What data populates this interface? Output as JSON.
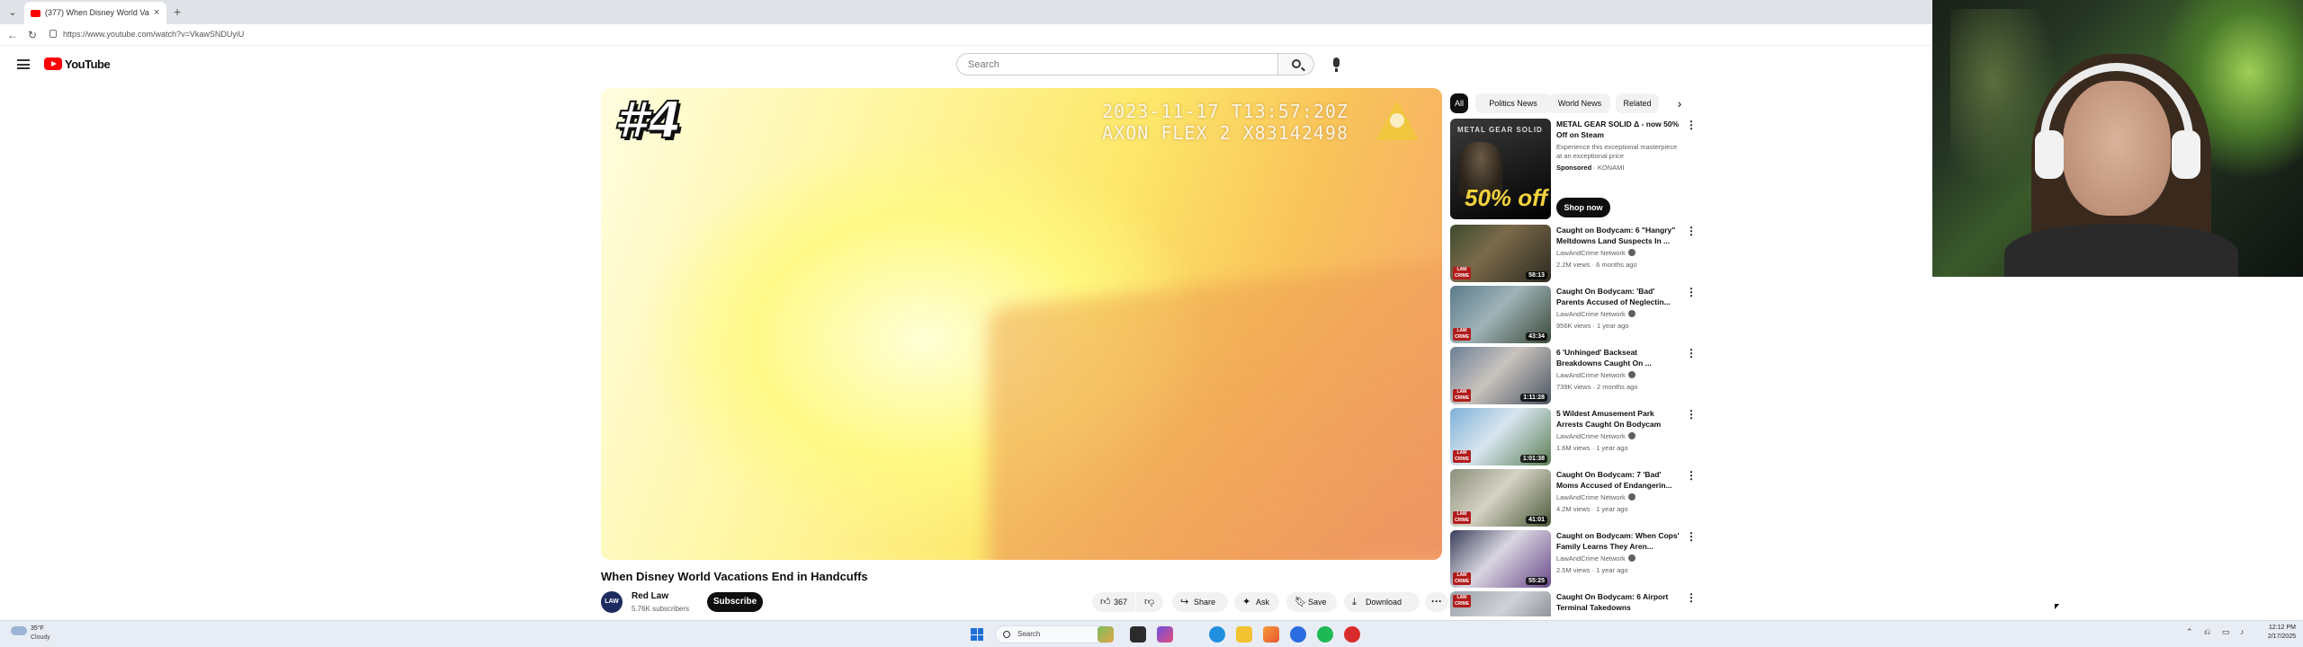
{
  "browser": {
    "tab_title": "(377) When Disney World Va",
    "url": "https://www.youtube.com/watch?v=VkawSNDUyiU",
    "new_tab_symbol": "+",
    "close_symbol": "×"
  },
  "youtube": {
    "logo_text": "YouTube",
    "search_placeholder": "Search"
  },
  "video": {
    "overlay_rank": "#4",
    "overlay_timestamp": "2023-11-17 T13:57:20Z",
    "overlay_device": "AXON FLEX 2 X83142498",
    "title": "When Disney World Vacations End in Handcuffs",
    "channel_name": "Red Law",
    "channel_avatar_text": "LAW",
    "channel_subs": "5.76K subscribers",
    "subscribe_label": "Subscribe",
    "like_count": "367",
    "share_label": "Share",
    "ask_label": "Ask",
    "save_label": "Save",
    "download_label": "Download",
    "more_label": "···"
  },
  "chips": [
    "All",
    "Politics News",
    "World News",
    "Related"
  ],
  "ad": {
    "thumb_top": "METAL GEAR SOLID",
    "thumb_sale": "50% off",
    "title": "METAL GEAR SOLID Δ - now 50% Off on Steam",
    "description": "Experience this exceptional masterpiece at an exceptional price",
    "sponsored_label": "Sponsored",
    "advertiser": "KONAMI",
    "cta_label": "Shop now"
  },
  "recommendations": [
    {
      "title": "Caught on Bodycam: 6 \"Hangry\" Meltdowns Land Suspects In ...",
      "channel": "LawAndCrime Network",
      "meta": "2.2M views · 6 months ago",
      "duration": "58:13",
      "badge": "LAW CRIME"
    },
    {
      "title": "Caught On Bodycam: 'Bad' Parents Accused of Neglectin...",
      "channel": "LawAndCrime Network",
      "meta": "956K views · 1 year ago",
      "duration": "43:34",
      "badge": "LAW CRIME"
    },
    {
      "title": "6 'Unhinged' Backseat Breakdowns Caught On ...",
      "channel": "LawAndCrime Network",
      "meta": "739K views · 2 months ago",
      "duration": "1:11:28",
      "badge": "LAW CRIME"
    },
    {
      "title": "5 Wildest Amusement Park Arrests Caught On Bodycam",
      "channel": "LawAndCrime Network",
      "meta": "1.6M views · 1 year ago",
      "duration": "1:01:38",
      "badge": "LAW CRIME"
    },
    {
      "title": "Caught On Bodycam: 7 'Bad' Moms Accused of Endangerin...",
      "channel": "LawAndCrime Network",
      "meta": "4.2M views · 1 year ago",
      "duration": "41:01",
      "badge": "LAW CRIME"
    },
    {
      "title": "Caught on Bodycam: When Cops' Family Learns They Aren...",
      "channel": "LawAndCrime Network",
      "meta": "2.5M views · 1 year ago",
      "duration": "55:25",
      "badge": "LAW CRIME"
    },
    {
      "title": "Caught On Bodycam: 6 Airport Terminal Takedowns",
      "channel": "LawAndCrime Network",
      "meta": "",
      "duration": "",
      "badge": "LAW CRIME"
    }
  ],
  "taskbar": {
    "weather_temp": "35°F",
    "weather_cond": "Cloudy",
    "search_label": "Search",
    "clock_time": "12:12 PM",
    "clock_date": "2/17/2025"
  }
}
